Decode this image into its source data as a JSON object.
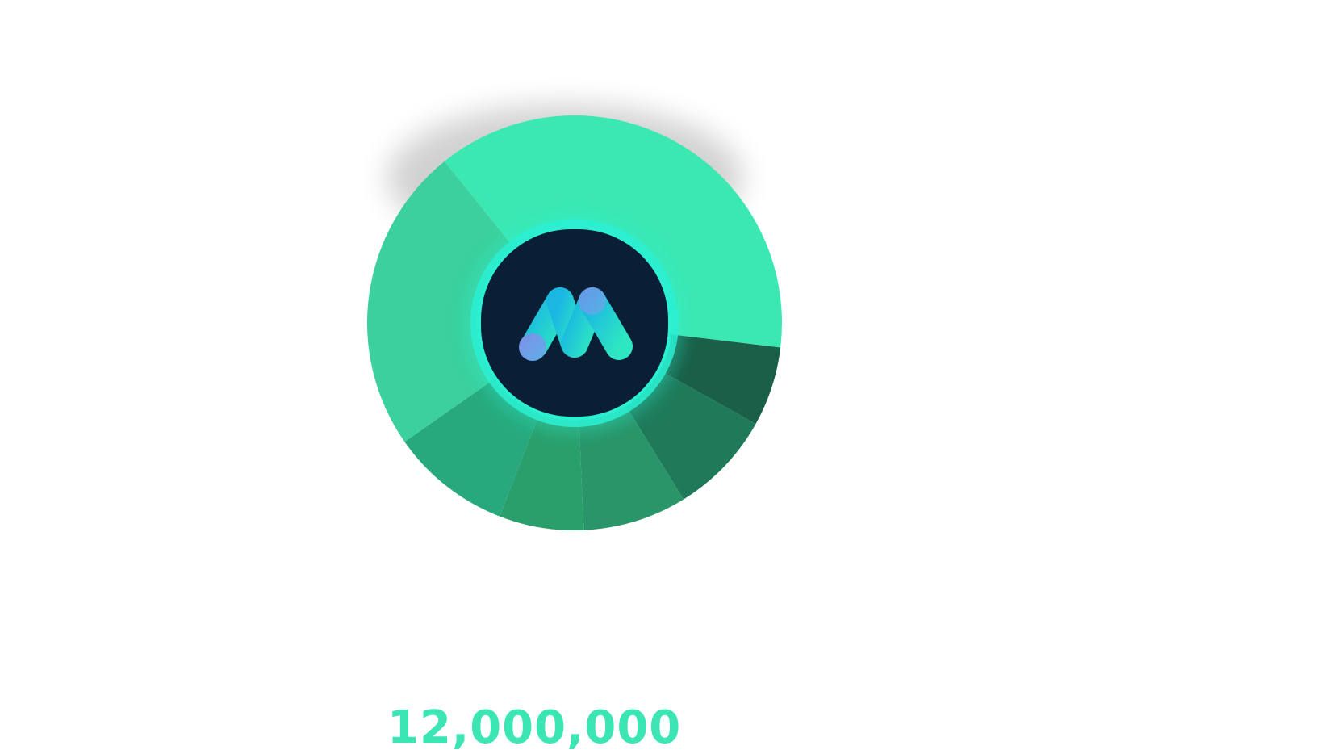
{
  "chart_data": {
    "type": "pie",
    "variant": "donut",
    "center_logo": "m-logo-icon",
    "total_label": "12,000,000",
    "legend": "none",
    "slices": [
      {
        "value": 0.377,
        "color": "#3ce8b2"
      },
      {
        "value": 0.062,
        "color": "#1a5f47"
      },
      {
        "value": 0.081,
        "color": "#1f7a5a"
      },
      {
        "value": 0.081,
        "color": "#2a9569"
      },
      {
        "value": 0.066,
        "color": "#2a9f6c"
      },
      {
        "value": 0.094,
        "color": "#27a97d"
      },
      {
        "value": 0.239,
        "color": "#3bd09d"
      }
    ]
  },
  "colors": {
    "logo_bg": "#0a1e36",
    "ring": "#2cf0d2",
    "logo_gradient_start": "#1bb7e2",
    "logo_gradient_end": "#2ee6c1",
    "logo_accent": "#7d8ee6",
    "total_text": "#3be5b4"
  }
}
